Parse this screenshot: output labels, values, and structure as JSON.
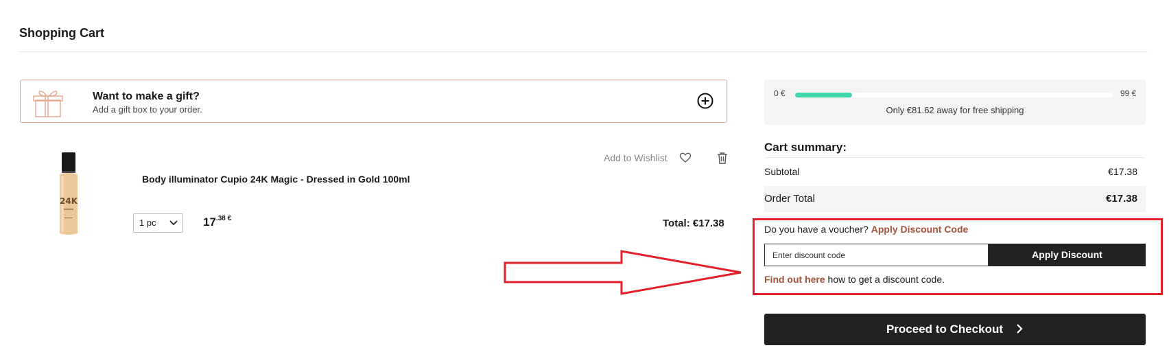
{
  "page": {
    "title": "Shopping Cart"
  },
  "gift": {
    "title": "Want to make a gift?",
    "subtitle": "Add a gift box to your order."
  },
  "product": {
    "name": "Body illuminator Cupio 24K Magic - Dressed in Gold 100ml",
    "wishlist_label": "Add to Wishlist",
    "quantity": "1 pc",
    "price_int": "17",
    "price_dec": ".38 €",
    "total_label": "Total:",
    "total_value": "€17.38"
  },
  "shipping": {
    "min_label": "0 €",
    "max_label": "99 €",
    "progress_fraction": 0.18,
    "message": "Only €81.62 away for free shipping"
  },
  "summary": {
    "title": "Cart summary:",
    "subtotal_label": "Subtotal",
    "subtotal_value": "€17.38",
    "order_total_label": "Order Total",
    "order_total_value": "€17.38"
  },
  "voucher": {
    "question": "Do you have a voucher?",
    "apply_link": "Apply Discount Code",
    "input_placeholder": "Enter discount code",
    "apply_button": "Apply Discount",
    "find_link": "Find out here",
    "find_rest": " how to get a discount code."
  },
  "checkout": {
    "label": "Proceed to Checkout"
  },
  "colors": {
    "accent_link": "#a0523a",
    "progress": "#3dd9ad",
    "highlight": "#e3202a",
    "gift_border": "#e9a58c"
  }
}
